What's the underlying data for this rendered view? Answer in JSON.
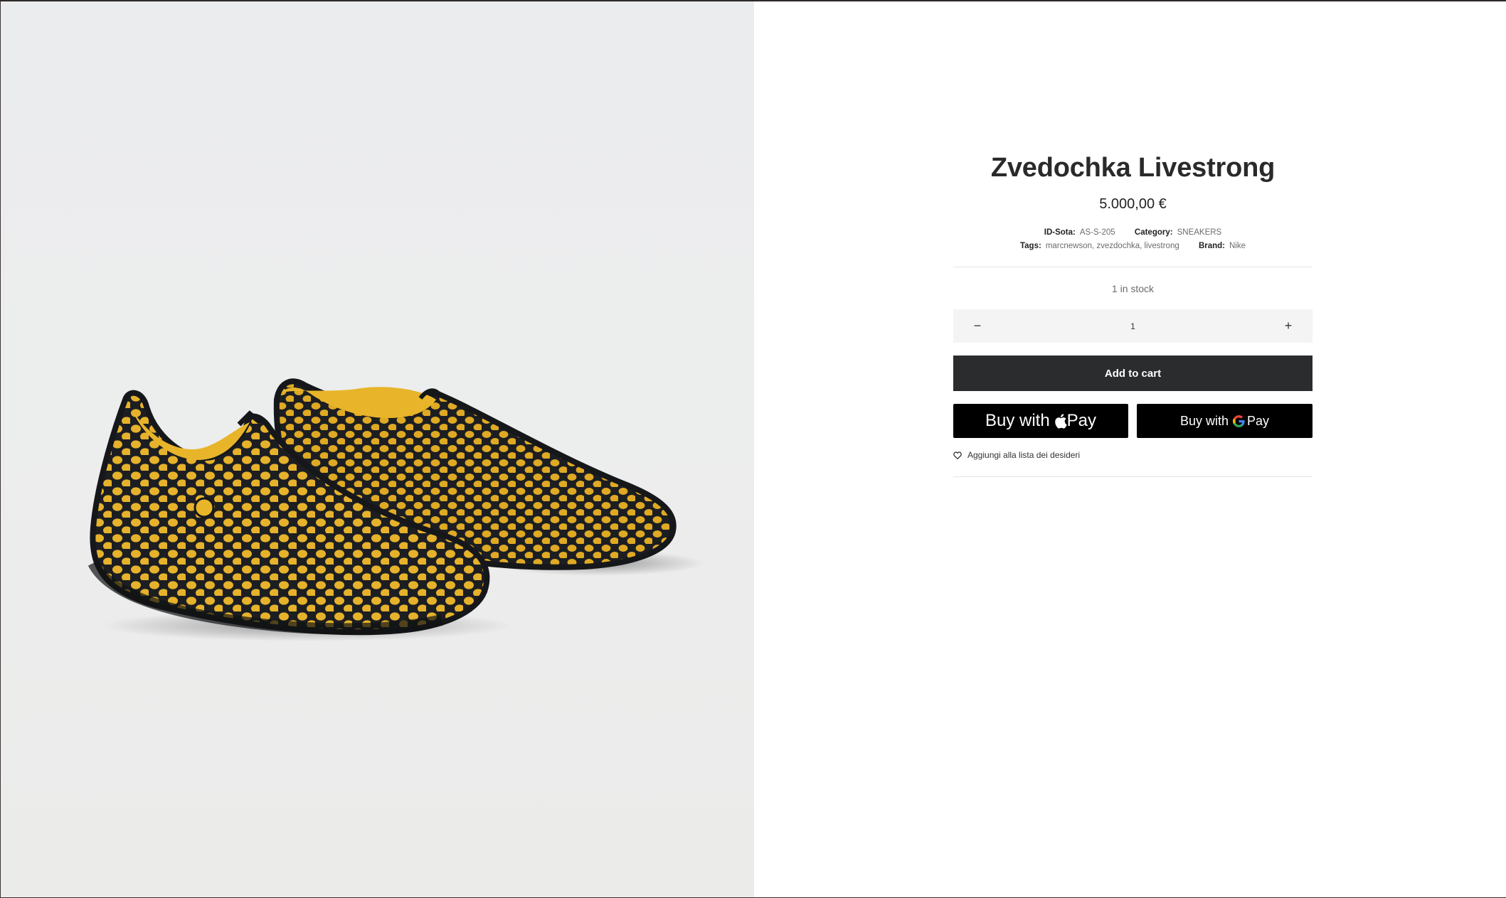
{
  "product": {
    "title": "Zvedochka Livestrong",
    "price": "5.000,00 €",
    "meta": {
      "id_label": "ID-Sota:",
      "id_value": "AS-S-205",
      "category_label": "Category:",
      "category_value": "SNEAKERS",
      "tags_label": "Tags:",
      "tags_value": "marcnewson, zvezdochka, livestrong",
      "brand_label": "Brand:",
      "brand_value": "Nike"
    },
    "stock": "1 in stock",
    "quantity": {
      "value": "1",
      "minus": "−",
      "plus": "+"
    },
    "add_to_cart": "Add to cart",
    "apple_pay": {
      "prefix": "Buy with",
      "word": "Pay"
    },
    "google_pay": {
      "prefix": "Buy with",
      "word": "Pay"
    },
    "wishlist": "Aggiungi alla lista dei desideri"
  },
  "image": {
    "subject": "black and yellow perforated shoes",
    "icons": [
      "apple-logo-icon",
      "google-g-icon",
      "heart-icon"
    ]
  },
  "colors": {
    "button_dark": "#2b2c2e",
    "pay_black": "#000000",
    "shoe_black": "#1d1f22",
    "shoe_yellow": "#e8b52a"
  }
}
